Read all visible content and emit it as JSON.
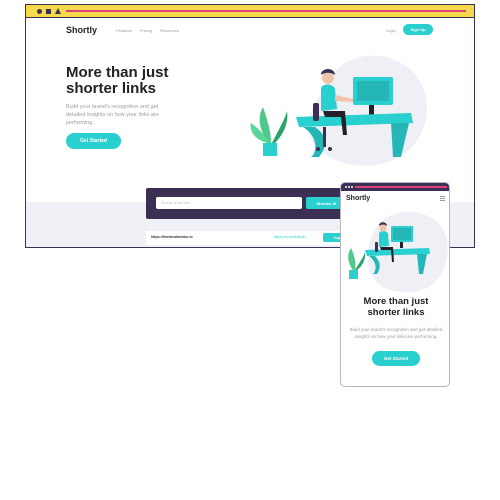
{
  "colors": {
    "accent": "#2acfcf",
    "dark_violet": "#3b3054",
    "window_bar": "#f4d94a",
    "bar_line": "#e0407a",
    "gray_text": "#9e9aa7",
    "very_dark": "#232127"
  },
  "desktop": {
    "titlebar_icons": [
      "circle-icon",
      "square-icon",
      "triangle-icon"
    ],
    "header": {
      "logo": "Shortly",
      "nav": [
        "Features",
        "Pricing",
        "Resources"
      ],
      "login": "Login",
      "signup": "Sign Up"
    },
    "hero": {
      "title": "More than just shorter links",
      "subtitle": "Build your brand's recognition and get detailed insights on how your links are performing.",
      "cta": "Get Started"
    },
    "shorten": {
      "placeholder": "Shorten a link here...",
      "button": "Shorten It!"
    },
    "result": {
      "original": "https://frontendmentor.io",
      "short": "https://rel.ink/k4lKyk",
      "copy": "Copy"
    }
  },
  "mobile": {
    "logo": "Shortly",
    "menu_icon": "hamburger-icon",
    "hero": {
      "title": "More than just shorter links",
      "subtitle": "Build your brand's recognition and get detailed insights on how your links are performing.",
      "cta": "Get Started"
    }
  }
}
